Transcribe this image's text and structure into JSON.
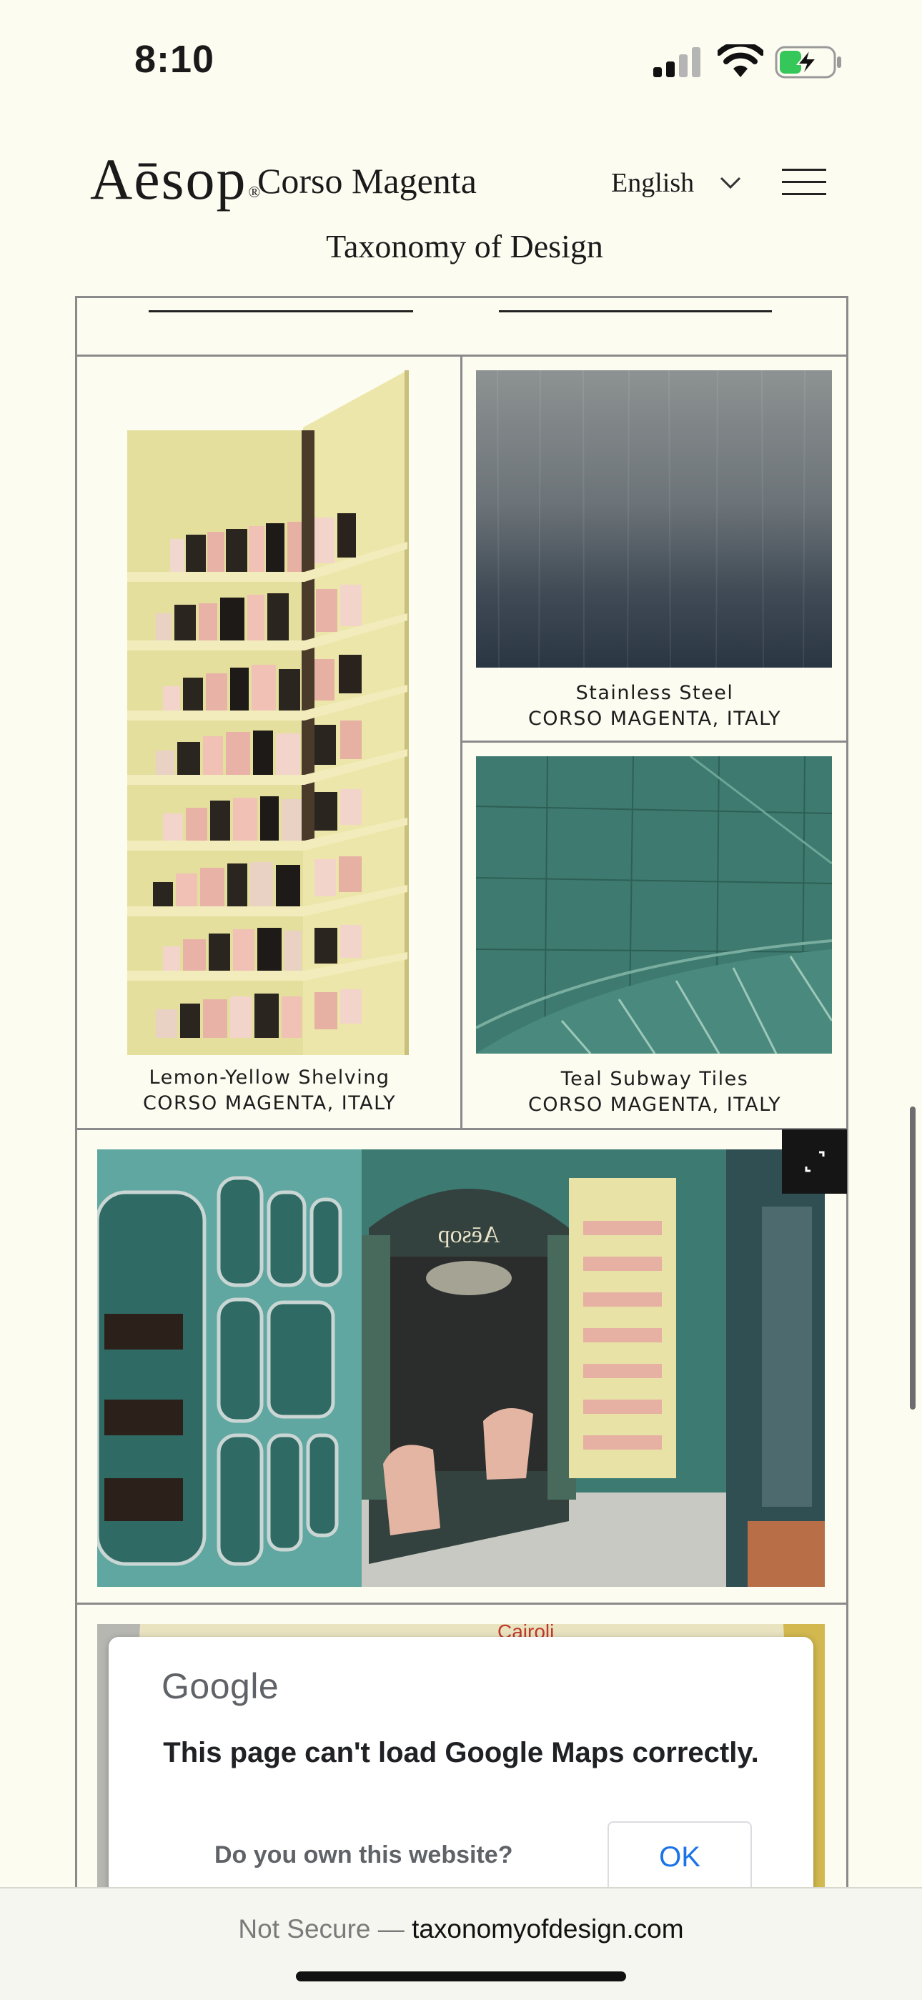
{
  "status_bar": {
    "time": "8:10"
  },
  "header": {
    "brand": "Aēsop",
    "registered_mark": "®",
    "store_name": "Corso Magenta",
    "language": "English",
    "site_title": "Taxonomy of Design"
  },
  "tiles": [
    {
      "title": "Lemon-Yellow Shelving",
      "location": "CORSO MAGENTA, ITALY"
    },
    {
      "title": "Stainless Steel",
      "location": "CORSO MAGENTA, ITALY"
    },
    {
      "title": "Teal Subway Tiles",
      "location": "CORSO MAGENTA, ITALY"
    }
  ],
  "storefront_sign": "Aēsop",
  "map_dialog": {
    "provider": "Google",
    "message": "This page can't load Google Maps correctly.",
    "question": "Do you own this website?",
    "ok_label": "OK",
    "map_label": "Cairoli"
  },
  "browser": {
    "security": "Not Secure —",
    "domain": "taxonomyofdesign.com"
  },
  "colors": {
    "page_bg": "#fdfcf1",
    "shelf_yellow": "#ece7a8",
    "teal": "#3f7f73",
    "link_blue": "#1a73e8"
  }
}
